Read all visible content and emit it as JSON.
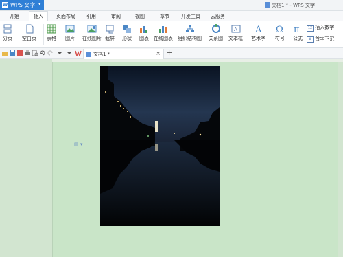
{
  "app": {
    "name": "WPS 文字",
    "logo": "W"
  },
  "window": {
    "title": "文档1 * - WPS 文字"
  },
  "menu_tabs": [
    {
      "label": "开始",
      "active": false
    },
    {
      "label": "插入",
      "active": true
    },
    {
      "label": "页面布局",
      "active": false
    },
    {
      "label": "引用",
      "active": false
    },
    {
      "label": "审阅",
      "active": false
    },
    {
      "label": "视图",
      "active": false
    },
    {
      "label": "章节",
      "active": false
    },
    {
      "label": "开发工具",
      "active": false
    },
    {
      "label": "云服务",
      "active": false
    }
  ],
  "ribbon": {
    "page_break": "分页",
    "blank_page": "空白页",
    "table": "表格",
    "picture": "图片",
    "online_picture": "在线图片",
    "screenshot": "截屏",
    "shapes": "形状",
    "chart": "图表",
    "online_chart": "在线图表",
    "org_chart": "组织结构图",
    "relation_chart": "关系图",
    "textbox": "文本框",
    "wordart": "艺术字",
    "symbol": "符号",
    "formula": "公式",
    "insert_number": "插入数字",
    "drop_cap": "首字下沉"
  },
  "doc_tab": {
    "name": "文档1 *",
    "close": "×",
    "new_tab": "+"
  },
  "colors": {
    "accent": "#2f7fd6",
    "page_bg": "#c9e5c8",
    "workspace_bg": "#d2e5d0"
  }
}
